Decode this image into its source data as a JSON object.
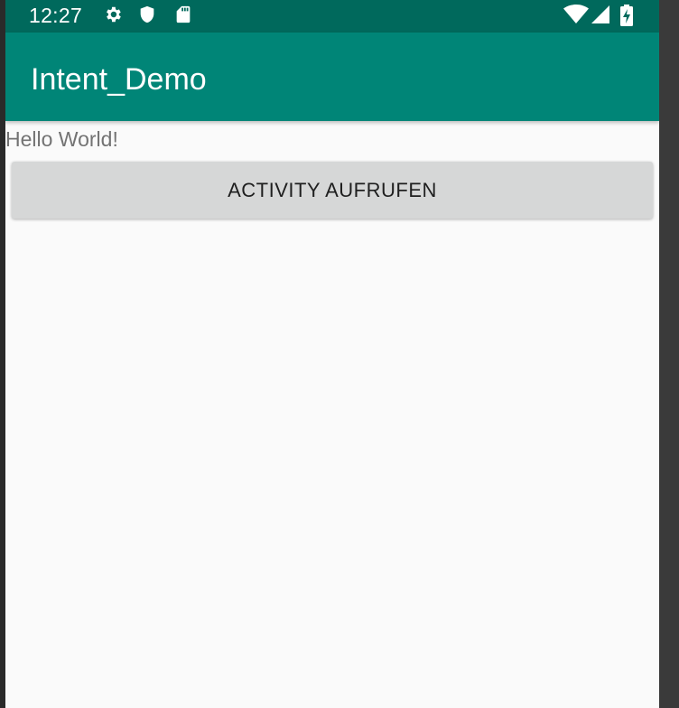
{
  "status_bar": {
    "time": "12:27",
    "icons": [
      "gear-icon",
      "shield-icon",
      "sd-card-icon",
      "wifi-icon",
      "signal-icon",
      "battery-icon"
    ]
  },
  "app_bar": {
    "title": "Intent_Demo"
  },
  "content": {
    "hello_text": "Hello World!",
    "button_label": "ACTIVITY AUFRUFEN"
  },
  "colors": {
    "status_bar": "#00695c",
    "app_bar": "#008577",
    "background": "#fafafa",
    "button": "#d6d7d7"
  }
}
